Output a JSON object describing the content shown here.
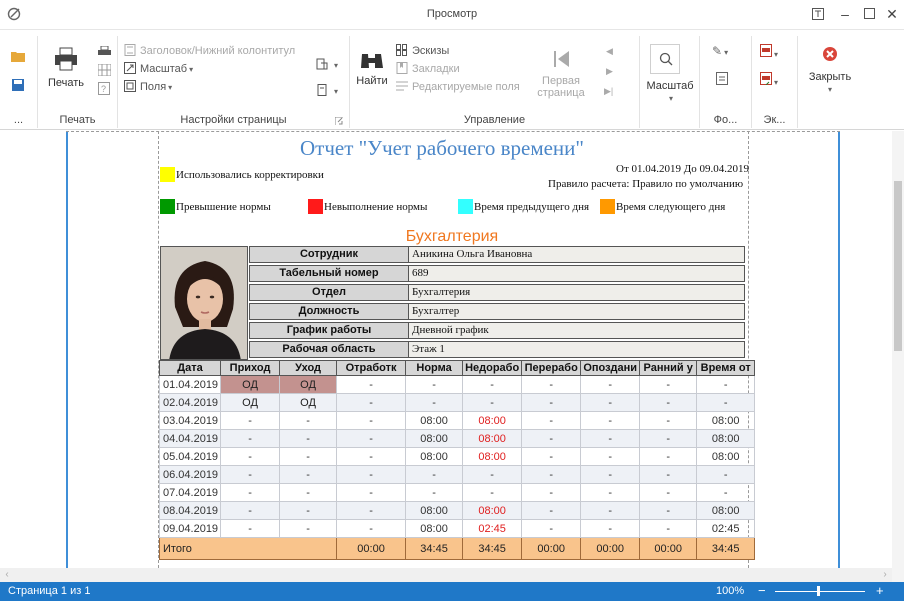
{
  "window": {
    "title": "Просмотр"
  },
  "ribbon": {
    "print_group": {
      "print_label": "Печать",
      "group_label": "Печать"
    },
    "page_setup_group": {
      "header_footer_label": "Заголовок/Нижний колонтитул",
      "scale_label": "Масштаб",
      "margins_label": "Поля",
      "group_label": "Настройки страницы"
    },
    "navigation_group": {
      "find_label": "Найти",
      "thumbnails_label": "Эскизы",
      "bookmarks_label": "Закладки",
      "editable_fields_label": "Редактируемые поля",
      "first_page_label_1": "Первая",
      "first_page_label_2": "страница",
      "group_label": "Управление"
    },
    "zoom_group": {
      "zoom_label": "Масштаб"
    },
    "background_group": {
      "group_label": "Фо..."
    },
    "export_group": {
      "group_label": "Эк..."
    },
    "close_group": {
      "close_label": "Закрыть"
    },
    "left_more": "..."
  },
  "report": {
    "title": "Отчет \"Учет рабочего времени\"",
    "period": "От 01.04.2019 До 09.04.2019",
    "calc_rule": "Правило расчета: Правило по умолчанию",
    "legend": [
      {
        "label": "Использовались корректировки",
        "color": "#ffff00"
      },
      {
        "label": "Превышение нормы",
        "color": "#009900"
      },
      {
        "label": "Невыполнение нормы",
        "color": "#ff1a1a"
      },
      {
        "label": "Время предыдущего дня",
        "color": "#33ffff"
      },
      {
        "label": "Время следующего дня",
        "color": "#ff9900"
      }
    ],
    "department": "Бухгалтерия",
    "info": [
      {
        "key": "Сотрудник",
        "value": "Аникина Ольга Ивановна"
      },
      {
        "key": "Табельный номер",
        "value": "689"
      },
      {
        "key": "Отдел",
        "value": "Бухгалтерия"
      },
      {
        "key": "Должность",
        "value": "Бухгалтер"
      },
      {
        "key": "График работы",
        "value": "Дневной график"
      },
      {
        "key": "Рабочая область",
        "value": "Этаж 1"
      }
    ],
    "columns": [
      "Дата",
      "Приход",
      "Уход",
      "Отработк",
      "Норма",
      "Недорабо",
      "Перерабо",
      "Опоздани",
      "Ранний у",
      "Время от"
    ],
    "rows": [
      [
        "01.04.2019",
        "ОД",
        "ОД",
        "-",
        "-",
        "-",
        "-",
        "-",
        "-",
        "-"
      ],
      [
        "02.04.2019",
        "ОД",
        "ОД",
        "-",
        "-",
        "-",
        "-",
        "-",
        "-",
        "-"
      ],
      [
        "03.04.2019",
        "-",
        "-",
        "-",
        "08:00",
        "08:00",
        "-",
        "-",
        "-",
        "08:00"
      ],
      [
        "04.04.2019",
        "-",
        "-",
        "-",
        "08:00",
        "08:00",
        "-",
        "-",
        "-",
        "08:00"
      ],
      [
        "05.04.2019",
        "-",
        "-",
        "-",
        "08:00",
        "08:00",
        "-",
        "-",
        "-",
        "08:00"
      ],
      [
        "06.04.2019",
        "-",
        "-",
        "-",
        "-",
        "-",
        "-",
        "-",
        "-",
        "-"
      ],
      [
        "07.04.2019",
        "-",
        "-",
        "-",
        "-",
        "-",
        "-",
        "-",
        "-",
        "-"
      ],
      [
        "08.04.2019",
        "-",
        "-",
        "-",
        "08:00",
        "08:00",
        "-",
        "-",
        "-",
        "08:00"
      ],
      [
        "09.04.2019",
        "-",
        "-",
        "-",
        "08:00",
        "02:45",
        "-",
        "-",
        "-",
        "02:45"
      ]
    ],
    "total": [
      "Итого",
      "",
      "",
      "00:00",
      "34:45",
      "34:45",
      "00:00",
      "00:00",
      "00:00",
      "34:45"
    ]
  },
  "statusbar": {
    "page": "Страница 1 из 1",
    "zoom": "100%",
    "minus": "−",
    "plus": "+"
  }
}
